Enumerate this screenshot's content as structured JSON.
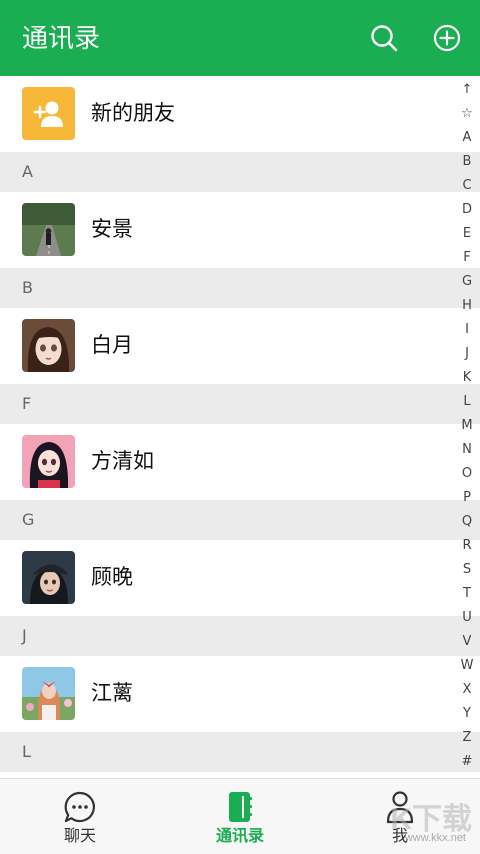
{
  "header": {
    "title": "通讯录",
    "search_icon": "search-icon",
    "add_icon": "plus-circle-icon",
    "background": "#1aad52"
  },
  "new_friend": {
    "label": "新的朋友",
    "icon": "add-user-icon",
    "icon_color": "#f7b83a"
  },
  "sections": [
    {
      "letter": "A",
      "contacts": [
        {
          "name": "安景",
          "avatar": "photo-road"
        }
      ]
    },
    {
      "letter": "B",
      "contacts": [
        {
          "name": "白月",
          "avatar": "photo-anime-girl"
        }
      ]
    },
    {
      "letter": "F",
      "contacts": [
        {
          "name": "方清如",
          "avatar": "photo-anime-girl-pink"
        }
      ]
    },
    {
      "letter": "G",
      "contacts": [
        {
          "name": "顾晚",
          "avatar": "photo-girl-cap"
        }
      ]
    },
    {
      "letter": "J",
      "contacts": [
        {
          "name": "江蓠",
          "avatar": "photo-girl-flowers"
        }
      ]
    },
    {
      "letter": "L",
      "contacts": []
    }
  ],
  "index_bar": [
    "↑",
    "☆",
    "A",
    "B",
    "C",
    "D",
    "E",
    "F",
    "G",
    "H",
    "I",
    "J",
    "K",
    "L",
    "M",
    "N",
    "O",
    "P",
    "Q",
    "R",
    "S",
    "T",
    "U",
    "V",
    "W",
    "X",
    "Y",
    "Z",
    "#"
  ],
  "tabbar": {
    "tabs": [
      {
        "label": "聊天",
        "icon": "chat-bubble-icon",
        "active": false
      },
      {
        "label": "通讯录",
        "icon": "contacts-book-icon",
        "active": true
      },
      {
        "label": "我",
        "icon": "person-icon",
        "active": false
      }
    ],
    "active_color": "#1aad52"
  },
  "watermark": {
    "logo": "K下载",
    "url": "www.kkx.net"
  }
}
